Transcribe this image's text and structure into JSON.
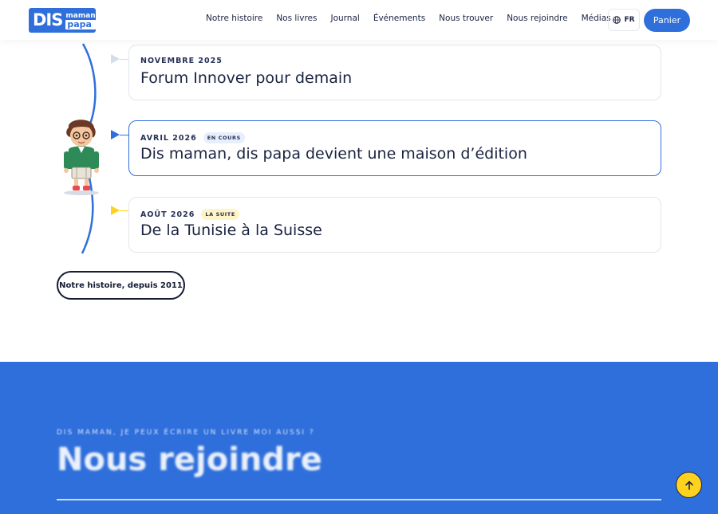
{
  "header": {
    "logo": {
      "big": "DIS",
      "line1": "maman",
      "line2": "papa"
    },
    "nav": [
      {
        "label": "Notre histoire"
      },
      {
        "label": "Nos livres"
      },
      {
        "label": "Journal"
      },
      {
        "label": "Événements"
      },
      {
        "label": "Nous trouver"
      },
      {
        "label": "Nous rejoindre"
      },
      {
        "label": "Médias"
      }
    ],
    "language": "FR",
    "cart_label": "Panier"
  },
  "timeline": [
    {
      "date": "NOVEMBRE 2025",
      "badge": "",
      "title": "Forum Innover pour demain"
    },
    {
      "date": "AVRIL 2026",
      "badge": "EN COURS",
      "title": "Dis maman, dis papa devient une maison d’édition"
    },
    {
      "date": "AOÛT 2026",
      "badge": "LA SUITE",
      "title": "De la Tunisie à la Suisse"
    }
  ],
  "history_button": "Notre histoire, depuis 2011",
  "join": {
    "eyebrow": "DIS MAMAN, JE PEUX ÉCRIRE UN LIVRE MOI AUSSI ?",
    "heading": "Nous rejoindre"
  },
  "colors": {
    "brand": "#2f6fdb",
    "accent": "#ffd21f",
    "ink": "#1a2340"
  },
  "icons": {
    "language": "globe-icon",
    "scroll_top": "arrow-up-icon"
  }
}
